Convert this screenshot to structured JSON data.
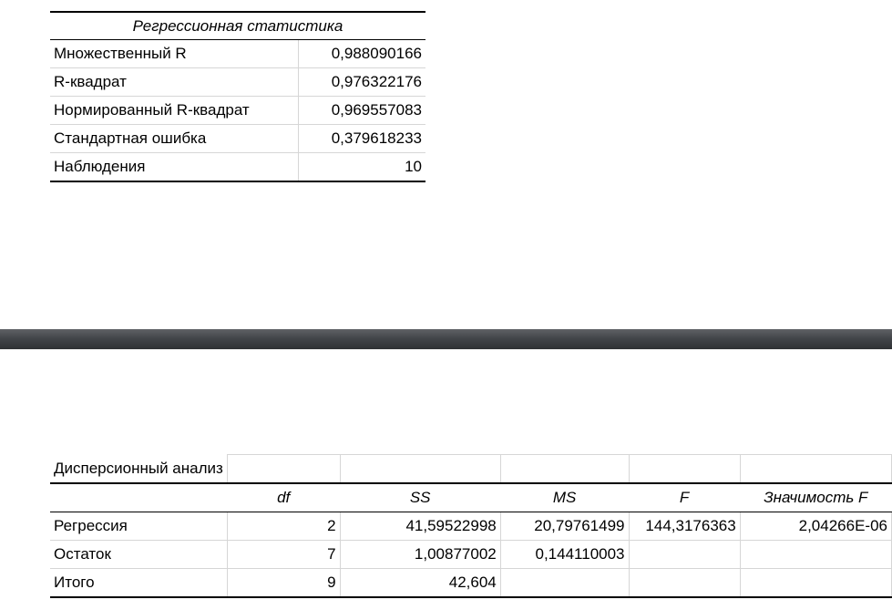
{
  "regression_statistics": {
    "title": "Регрессионная статистика",
    "rows": [
      {
        "label": "Множественный R",
        "value": "0,988090166"
      },
      {
        "label": "R-квадрат",
        "value": "0,976322176"
      },
      {
        "label": "Нормированный R-квадрат",
        "value": "0,969557083"
      },
      {
        "label": "Стандартная ошибка",
        "value": "0,379618233"
      },
      {
        "label": "Наблюдения",
        "value": "10"
      }
    ]
  },
  "anova": {
    "title": "Дисперсионный анализ",
    "columns": [
      "",
      "df",
      "SS",
      "MS",
      "F",
      "Значимость F"
    ],
    "rows": [
      {
        "label": "Регрессия",
        "df": "2",
        "ss": "41,59522998",
        "ms": "20,79761499",
        "f": "144,3176363",
        "sig": "2,04266E-06"
      },
      {
        "label": "Остаток",
        "df": "7",
        "ss": "1,00877002",
        "ms": "0,144110003",
        "f": "",
        "sig": ""
      },
      {
        "label": "Итого",
        "df": "9",
        "ss": "42,604",
        "ms": "",
        "f": "",
        "sig": ""
      }
    ]
  },
  "colors": {
    "separator_bar": "#43464a",
    "grid_line": "#d6d6d6",
    "rule": "#000000"
  }
}
